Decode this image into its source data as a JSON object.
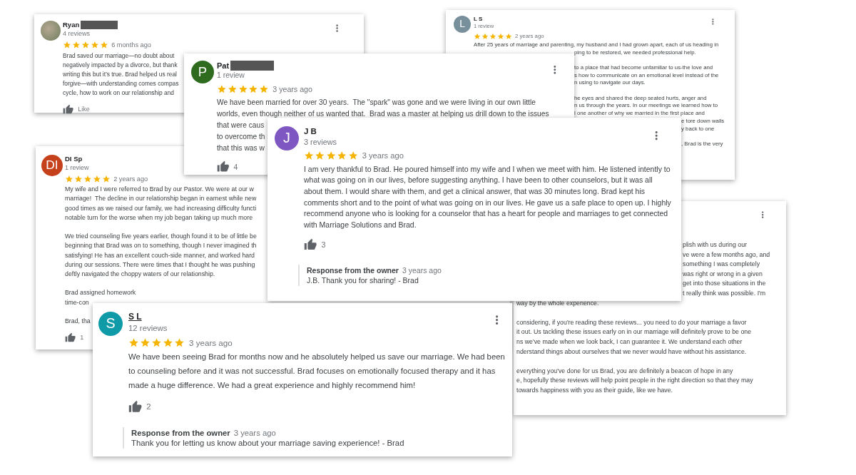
{
  "reviews": [
    {
      "reviewer": "Ryan",
      "name_redacted": true,
      "avatar": {
        "kind": "photo"
      },
      "review_count": "4 reviews",
      "stars": 5,
      "time": "6 months ago",
      "has_menu": true,
      "paragraphs": [
        [
          {
            "kind": "full",
            "lines": [
              "Brad saved our marriage—no doubt about",
              "negatively impacted by a divorce, but thank",
              "writing this but it’s true. Brad helped us real",
              "forgive—with understanding comes compas",
              "cycle, how to work on our relationship and"
            ]
          }
        ]
      ],
      "likes": "Like"
    },
    {
      "reviewer": "L S",
      "avatar": {
        "kind": "letter",
        "letter": "L",
        "color": "#78909c"
      },
      "review_count": "1 review",
      "stars": 5,
      "time": "2 years ago",
      "has_menu": true,
      "paragraphs": [
        [
          {
            "kind": "full",
            "lines": [
              "After 25 years of marriage and parenting, my husband and I had grown apart, each of us heading in"
            ]
          },
          {
            "kind": "partly_covered",
            "lines": [
              "ping to be restored, we needed professional help."
            ]
          }
        ],
        [
          {
            "kind": "partly_covered",
            "lines": [
              "to a place that had become unfamiliar to us-the love and",
              "s how to communicate on an emotional level instead of the",
              "n using to navigate our days."
            ]
          }
        ],
        [
          {
            "kind": "partly_covered",
            "lines": [
              "he eyes and shared the deep seated hurts, anger and",
              "n us through the years. In our meetings we learned how to",
              "l one another of why we married in the first place and"
            ]
          },
          {
            "kind": "mostly_covered",
            "lines": [
              "e tore down walls",
              "y back to one"
            ]
          }
        ],
        [
          {
            "kind": "mostly_covered",
            "lines": [
              ", Brad is the very"
            ]
          }
        ]
      ]
    },
    {
      "reviewer": "DI Sp",
      "avatar": {
        "kind": "letter",
        "letter": "DI",
        "color": "#c5411b"
      },
      "review_count": "1 review",
      "stars": 5,
      "time": "2 years ago",
      "paragraphs": [
        [
          {
            "kind": "full",
            "lines": [
              "My wife and I were referred to Brad by our Pastor. We were at our w",
              "marriage!  The decline in our relationship began in earnest while new",
              "good times as we raised our family, we had increasing difficulty functi",
              "notable turn for the worse when my job began taking up much more"
            ]
          }
        ],
        [
          {
            "kind": "full",
            "lines": [
              "We tried counseling five years earlier, though found it to be of little be",
              "beginning that Brad was on to something, though I never imagined th",
              "satisfying! He has an excellent couch-side manner, and worked hard",
              "during our sessions. There were times that I thought he was pushing",
              "deftly navigated the choppy waters of our relationship."
            ]
          }
        ],
        [
          {
            "kind": "full",
            "lines": [
              "Brad assigned homework",
              "time-con"
            ]
          }
        ],
        [
          {
            "kind": "full",
            "lines": [
              "Brad, tha"
            ]
          }
        ]
      ],
      "likes": "1"
    },
    {
      "reviewer": "Pat",
      "name_redacted": true,
      "avatar": {
        "kind": "letter",
        "letter": "P",
        "color": "#2e6b1e"
      },
      "review_count": "1 review",
      "stars": 5,
      "time": "3 years ago",
      "has_menu": true,
      "paragraphs": [
        [
          {
            "kind": "full",
            "lines": [
              "We have been married for over 30 years.  The \"spark\" was gone and we were living in our own little",
              "worlds, even though neither of us wanted that.  Brad was a master at helping us drill down to the issues",
              "that were caus",
              "to overcome th",
              "that this was w"
            ]
          }
        ]
      ],
      "likes": "4"
    },
    {
      "has_menu": true,
      "paragraphs": [
        [
          {
            "kind": "partly_covered",
            "lines": [
              "plish with us during our",
              "ve were a few months ago, and",
              "something I was completely",
              "was right or wrong in a given",
              "get into those situations in the",
              "t really think was possible. I'm"
            ]
          },
          {
            "kind": "full",
            "lines": [
              "way by the whole experience."
            ]
          }
        ],
        [
          {
            "kind": "full",
            "lines": [
              "considering, if you're reading these reviews... you need to do your marriage a favor",
              "it out. Us tackling these issues early on in our marriage will definitely prove to be one",
              "ns we've made when we look back, I can guarantee it. We understand each other",
              "nderstand things about ourselves that we never would have without his assistance."
            ]
          }
        ],
        [
          {
            "kind": "full",
            "lines": [
              "everything you've done for us Brad, you are definitely a beacon of hope in any",
              "e, hopefully these reviews will help point people in the right direction so that they may",
              "towards happiness with you as their guide, like we have."
            ]
          }
        ]
      ]
    },
    {
      "reviewer": "J B",
      "avatar": {
        "kind": "letter",
        "letter": "J",
        "color": "#7e57c2"
      },
      "review_count": "3 reviews",
      "stars": 5,
      "time": "3 years ago",
      "has_menu": true,
      "text": "I am very thankful to Brad. He poured himself into my wife and I when we meet with him. He listened intently to what was going on in our lives, before suggesting anything. I have been to other counselors, but it was all about them. I would share with them, and get a clinical answer, that was 30 minutes long. Brad kept his comments short and to the point of what was going on in our lives. He gave us a safe place to open up. I highly recommend anyone who is looking for a counselor that has a heart for people and marriages to get connected with Marriage Solutions and Brad.",
      "likes": "3",
      "response": {
        "label": "Response from the owner",
        "time": "3 years ago",
        "text": "J.B. Thank you for sharing! - Brad"
      }
    },
    {
      "reviewer": "S L",
      "name_underlined": true,
      "avatar": {
        "kind": "letter",
        "letter": "S",
        "color": "#0e9aa7"
      },
      "review_count": "12 reviews",
      "stars": 5,
      "time": "3 years ago",
      "has_menu": true,
      "text": "We have been seeing Brad for months now and he absolutely helped us save our marriage. We had been to counseling before and it was not successful. Brad focuses on emotionally focused therapy and it has made a huge difference. We had a great experience and highly recommend him!",
      "likes": "2",
      "response": {
        "label": "Response from the owner",
        "time": "3 years ago",
        "text": "Thank you for letting us know about your marriage saving experience! - Brad"
      }
    }
  ]
}
